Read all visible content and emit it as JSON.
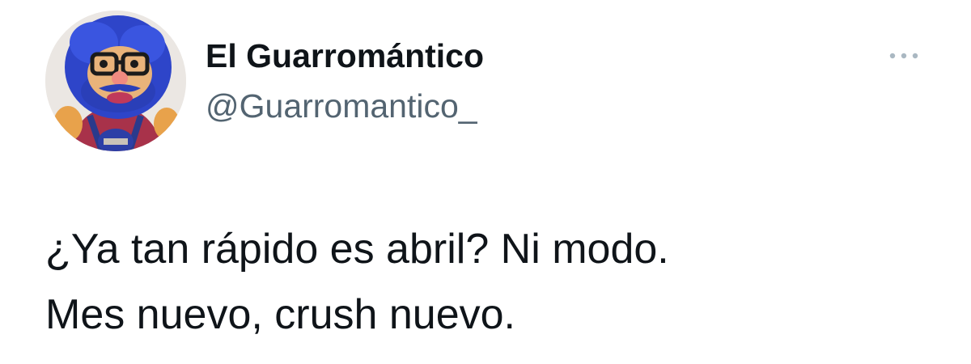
{
  "author": {
    "display_name": "El Guarromántico",
    "handle": "@Guarromantico_"
  },
  "tweet": {
    "lines": [
      "¿Ya tan rápido es abril? Ni modo.",
      "Mes nuevo, crush nuevo."
    ]
  },
  "icons": {
    "more": "more-horizontal-icon",
    "avatar": "puppet-avatar"
  },
  "colors": {
    "text": "#0f1419",
    "secondary_text": "#536471",
    "background": "#ffffff"
  }
}
